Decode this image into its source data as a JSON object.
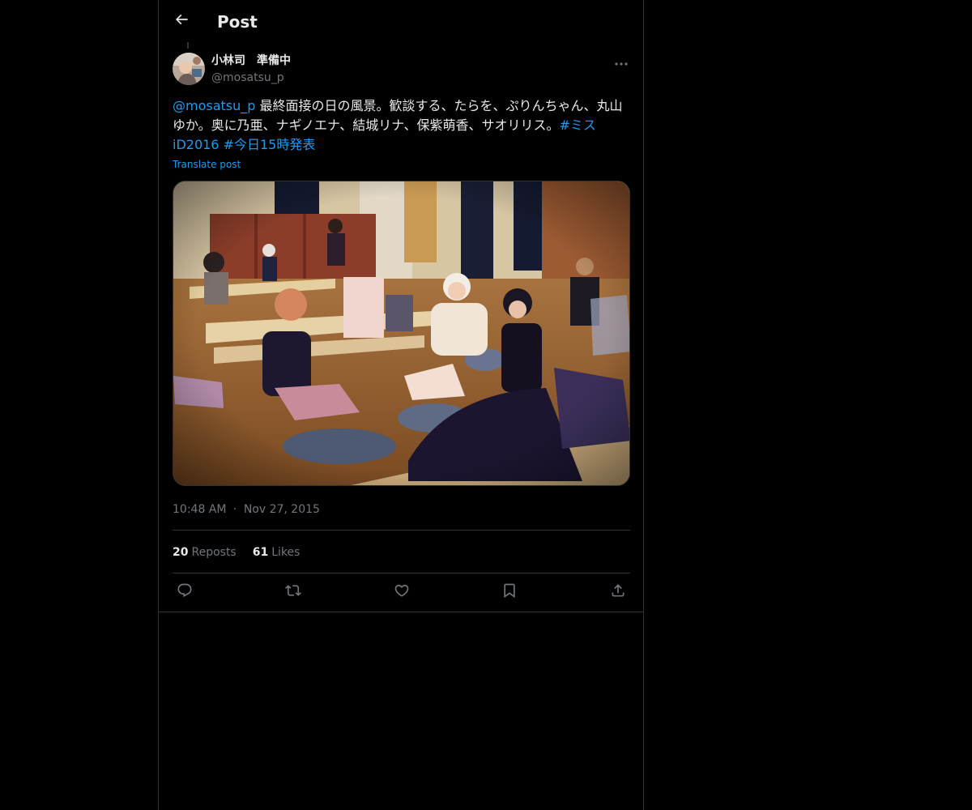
{
  "header": {
    "title": "Post",
    "back_icon": "arrow-left-icon"
  },
  "post": {
    "author": {
      "display_name": "小林司　準備中",
      "handle": "@mosatsu_p"
    },
    "text": {
      "mention": "@mosatsu_p",
      "body": " 最終面接の日の風景。歓談する、たらを、ぷりんちゃん、丸山ゆか。奥に乃亜、ナギノエナ、結城リナ、保紫萌香、サオリリス。",
      "hashtag1": "#ミスiD2016",
      "space": " ",
      "hashtag2": "#今日15時発表"
    },
    "translate_label": "Translate post",
    "time": "10:48 AM",
    "separator": "·",
    "date": "Nov 27, 2015",
    "stats": {
      "reposts_count": "20",
      "reposts_label": "Reposts",
      "likes_count": "61",
      "likes_label": "Likes"
    },
    "actions": [
      "reply-icon",
      "repost-icon",
      "like-icon",
      "bookmark-icon",
      "share-icon"
    ]
  },
  "colors": {
    "background": "#000000",
    "text_primary": "#e7e9ea",
    "text_secondary": "#71767b",
    "link": "#1d9bf0",
    "border": "#2f3336"
  }
}
